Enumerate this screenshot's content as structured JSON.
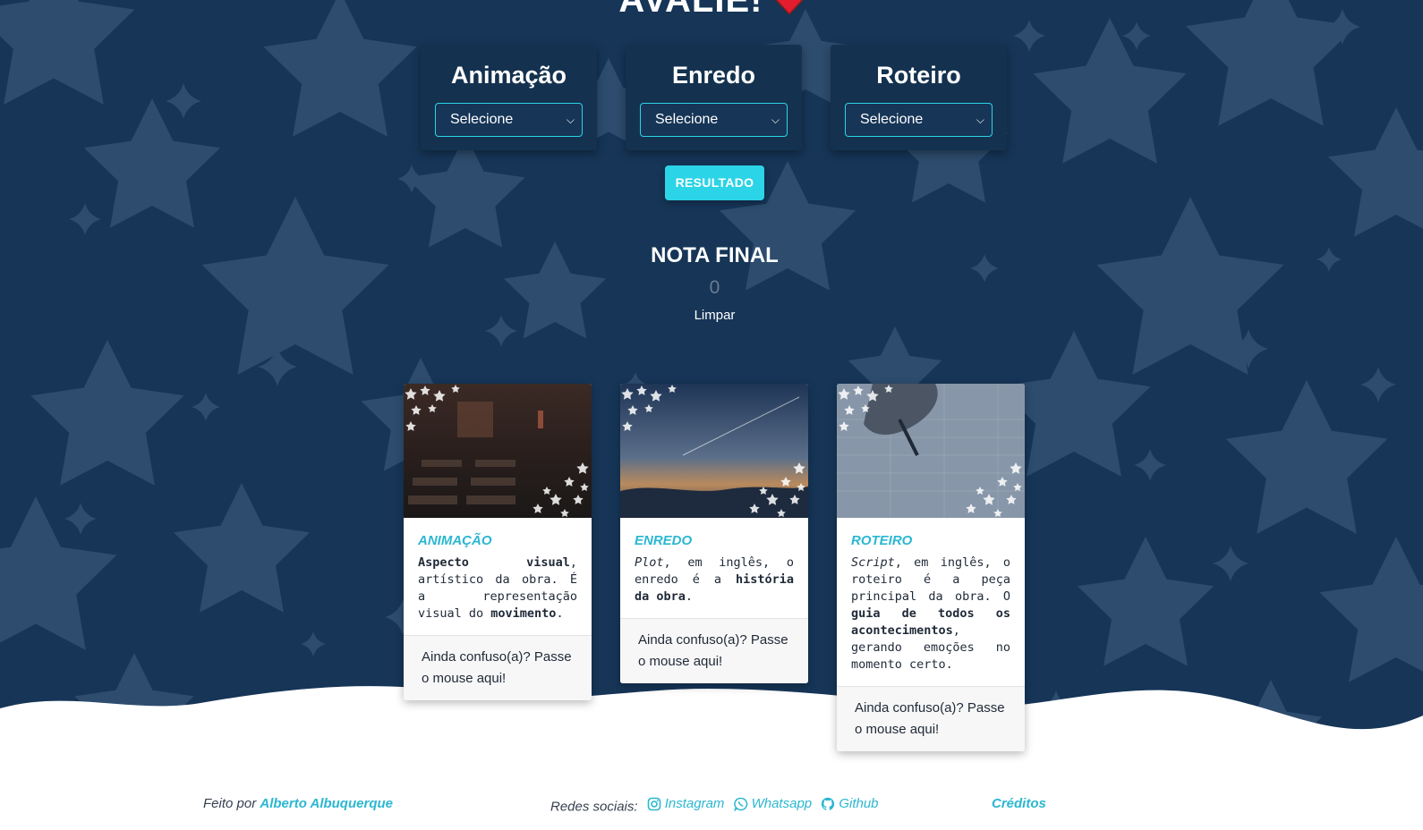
{
  "header": {
    "title": "AVALIE!",
    "heart_icon": "heart-icon"
  },
  "selectors": [
    {
      "title": "Animação",
      "value": "Selecione"
    },
    {
      "title": "Enredo",
      "value": "Selecione"
    },
    {
      "title": "Roteiro",
      "value": "Selecione"
    }
  ],
  "result_button": {
    "label": "RESULTADO"
  },
  "nota": {
    "title": "NOTA FINAL",
    "value": "0",
    "clear_label": "Limpar"
  },
  "cards": [
    {
      "title": "ANIMAÇÃO",
      "footer": "Ainda confuso(a)? Passe o mouse aqui!"
    },
    {
      "title": "ENREDO",
      "footer": "Ainda confuso(a)? Passe o mouse aqui!"
    },
    {
      "title": "ROTEIRO",
      "footer": "Ainda confuso(a)? Passe o mouse aqui!"
    }
  ],
  "card_text": {
    "animacao": {
      "a": "Aspecto visual",
      "b": ", artístico da obra. É a representação visual do ",
      "c": "movimento",
      "d": "."
    },
    "enredo": {
      "a": "Plot",
      "b": ", em inglês, o enredo é a ",
      "c": "história da obra",
      "d": "."
    },
    "roteiro": {
      "a": "Script",
      "b": ", em inglês, o roteiro é a peça principal da obra. O ",
      "c": "guia de todos os acontecimentos",
      "d": ", gerando emoções no momento certo."
    }
  },
  "footer": {
    "made_by_prefix": "Feito por",
    "author": "Alberto Albuquerque",
    "social_prefix": "Redes sociais:",
    "instagram": "Instagram",
    "whatsapp": "Whatsapp",
    "github": "Github",
    "credits": "Créditos"
  },
  "colors": {
    "background": "#163557",
    "accent": "#2bd4e6",
    "link": "#2bb7d1",
    "star": "#2d4c6e"
  }
}
